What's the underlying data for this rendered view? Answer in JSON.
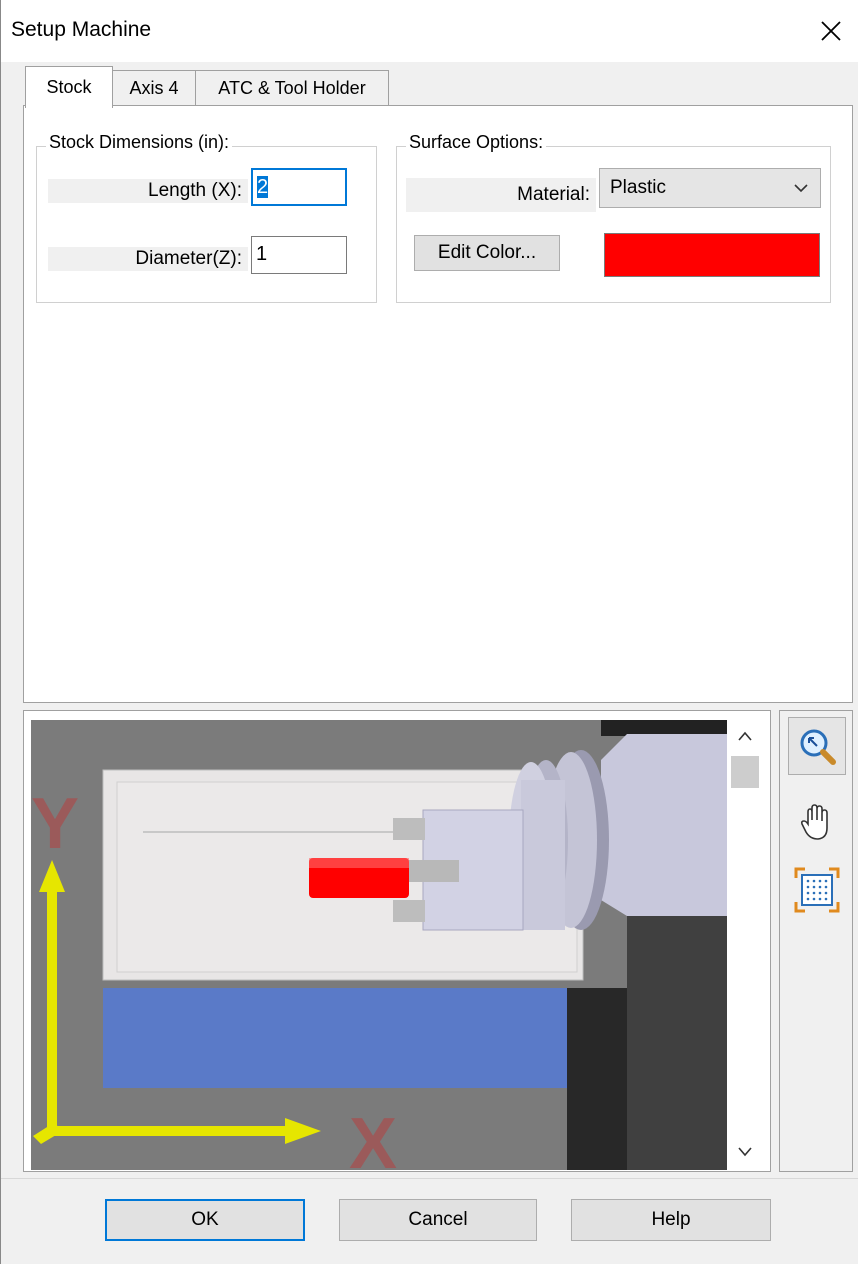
{
  "window": {
    "title": "Setup Machine",
    "close_icon": "close-icon"
  },
  "tabs": [
    {
      "label": "Stock",
      "active": true
    },
    {
      "label": "Axis 4",
      "active": false
    },
    {
      "label": "ATC & Tool Holder",
      "active": false
    }
  ],
  "stock_dimensions": {
    "group_label": "Stock Dimensions (in):",
    "length_label": "Length (X):",
    "length_value": "2",
    "diameter_label": "Diameter(Z):",
    "diameter_value": "1"
  },
  "surface_options": {
    "group_label": "Surface Options:",
    "material_label": "Material:",
    "material_value": "Plastic",
    "edit_color_label": "Edit Color...",
    "stock_color": "#ff0000"
  },
  "viewport": {
    "axis_y_label": "Y",
    "axis_x_label": "X",
    "axis_arrow_color": "#e6e600",
    "axis_letter_color": "#9b5a5a",
    "bed_color": "#5a7ac8"
  },
  "side_tools": [
    {
      "icon": "zoom-icon"
    },
    {
      "icon": "pan-hand-icon"
    },
    {
      "icon": "fit-view-icon"
    }
  ],
  "buttons": {
    "ok": "OK",
    "cancel": "Cancel",
    "help": "Help"
  }
}
